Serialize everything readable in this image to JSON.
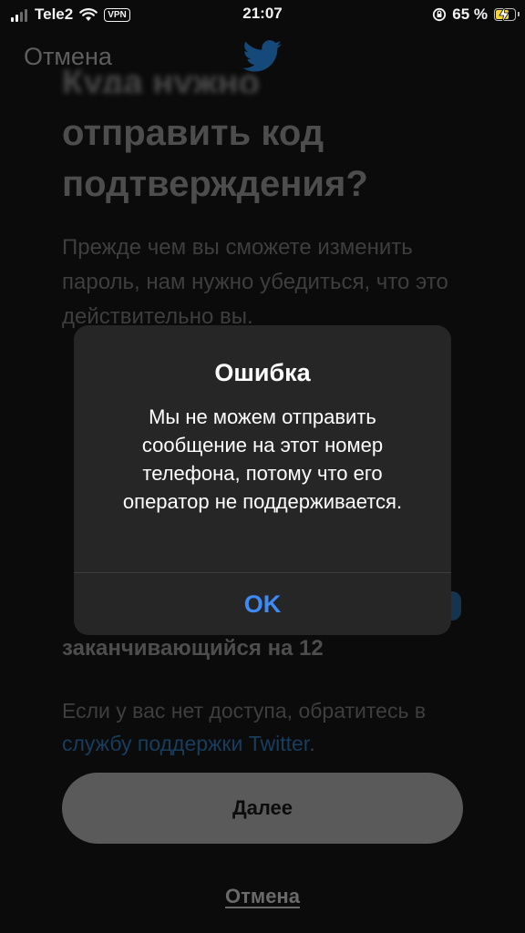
{
  "status_bar": {
    "carrier": "Tele2",
    "vpn_label": "VPN",
    "time": "21:07",
    "battery_percent": "65 %",
    "battery_level": 0.65
  },
  "nav": {
    "cancel_label": "Отмена",
    "logo_icon": "twitter-bird-icon"
  },
  "screen": {
    "title_line_0": "Куда нужно",
    "title": "отправить код подтверждения?",
    "description": "Прежде чем вы сможете изменить пароль, нам нужно убедиться, что это действительно вы.",
    "bold_last_line": "заканчивающийся на 12",
    "help_prefix": "Если у вас нет доступа, обратитесь в ",
    "help_link": "службу поддержки Twitter",
    "help_suffix": ".",
    "next_button": "Далее",
    "bottom_cancel": "Отмена"
  },
  "alert": {
    "title": "Ошибка",
    "message": "Мы не можем отправить сообщение на этот номер телефона, потому что его оператор не поддерживается.",
    "ok_button": "OK"
  },
  "colors": {
    "alert_bg": "#262626",
    "ok_blue": "#3f8af5",
    "battery_fill": "#f5d33a",
    "link_blue_dimmed": "#173e5e"
  }
}
